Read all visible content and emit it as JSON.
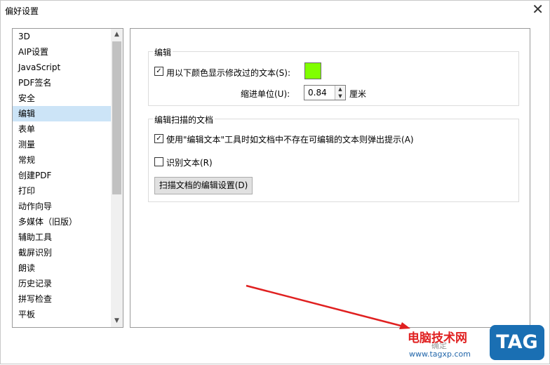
{
  "window": {
    "title": "偏好设置",
    "close_label": "✕"
  },
  "sidebar": {
    "items": [
      {
        "label": "3D"
      },
      {
        "label": "AIP设置"
      },
      {
        "label": "JavaScript"
      },
      {
        "label": "PDF签名"
      },
      {
        "label": "安全"
      },
      {
        "label": "编辑",
        "selected": true
      },
      {
        "label": "表单"
      },
      {
        "label": "测量"
      },
      {
        "label": "常规"
      },
      {
        "label": "创建PDF"
      },
      {
        "label": "打印"
      },
      {
        "label": "动作向导"
      },
      {
        "label": "多媒体（旧版）"
      },
      {
        "label": "辅助工具"
      },
      {
        "label": "截屏识别"
      },
      {
        "label": "朗读"
      },
      {
        "label": "历史记录"
      },
      {
        "label": "拼写检查"
      },
      {
        "label": "平板"
      }
    ],
    "scroll_up": "▲",
    "scroll_down": "▼"
  },
  "edit_group": {
    "title": "编辑",
    "color_checkbox_label": "用以下颜色显示修改过的文本(S):",
    "color_checked": true,
    "color": "#80ff00",
    "indent_label": "缩进单位(U):",
    "indent_value": "0.84",
    "indent_unit": "厘米"
  },
  "scan_group": {
    "title": "编辑扫描的文档",
    "tip_checkbox_label": "使用\"编辑文本\"工具时如文档中不存在可编辑的文本则弹出提示(A)",
    "tip_checked": true,
    "ocr_checkbox_label": "识别文本(R)",
    "ocr_checked": false,
    "settings_button": "扫描文档的编辑设置(D)"
  },
  "footer": {
    "ok_label": "确定",
    "watermark_site": "电脑技术网",
    "watermark_url": "www.tagxp.com",
    "tag_logo": "TAG"
  },
  "colors": {
    "selection": "#cce4f7",
    "arrow": "#e02020",
    "logo_bg": "#1a6fb3"
  }
}
